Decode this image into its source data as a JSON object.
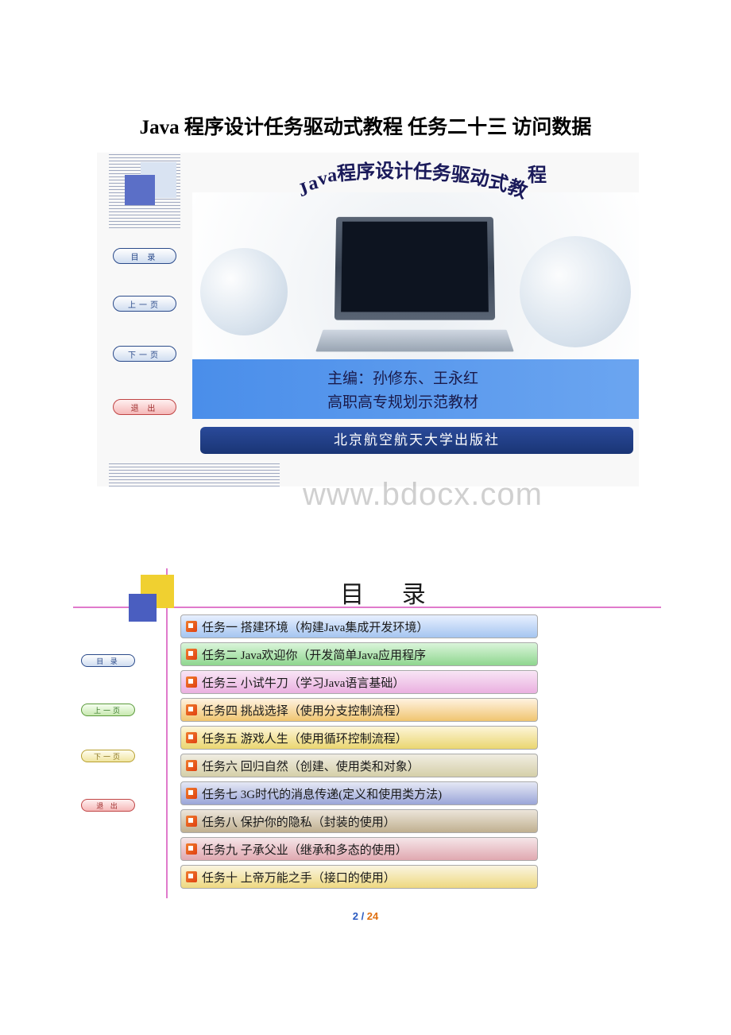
{
  "page_title": "Java 程序设计任务驱动式教程 任务二十三 访问数据",
  "slide1": {
    "curved_title_chars": [
      "J",
      "a",
      "v",
      "a",
      "程",
      "序",
      "设",
      "计",
      "任",
      "务",
      "驱",
      "动",
      "式",
      "教",
      "程"
    ],
    "nav": {
      "toc": "目 录",
      "prev": "上一页",
      "next": "下一页",
      "exit": "退 出"
    },
    "editors_line": "主编：孙修东、王永红",
    "subtitle_line": "高职高专规划示范教材",
    "publisher": "北京航空航天大学出版社",
    "watermark": "www.bdocx.com"
  },
  "slide2": {
    "title": "目 录",
    "nav": {
      "toc": "目 录",
      "prev": "上一页",
      "next": "下一页",
      "exit": "退 出"
    },
    "items": [
      {
        "label": "任务一  搭建环境（构建Java集成开发环境）",
        "grad": [
          "#e8f0ff",
          "#a5c5f0"
        ]
      },
      {
        "label": "任务二  Java欢迎你（开发简单Java应用程序",
        "grad": [
          "#daf5da",
          "#8fd68f"
        ]
      },
      {
        "label": "任务三  小试牛刀（学习Java语言基础）",
        "grad": [
          "#f8e5f5",
          "#eab0e0"
        ]
      },
      {
        "label": "任务四  挑战选择（使用分支控制流程）",
        "grad": [
          "#fff2e0",
          "#f0c570"
        ]
      },
      {
        "label": "任务五  游戏人生（使用循环控制流程）",
        "grad": [
          "#fdf5d8",
          "#ead670"
        ]
      },
      {
        "label": "任务六  回归自然（创建、使用类和对象）",
        "grad": [
          "#f0ede2",
          "#d5cfa8"
        ]
      },
      {
        "label": "任务七  3G时代的消息传递(定义和使用类方法)",
        "grad": [
          "#e5e8f5",
          "#9aa5d8"
        ]
      },
      {
        "label": "任务八  保护你的隐私（封装的使用）",
        "grad": [
          "#ece5da",
          "#c0b090"
        ]
      },
      {
        "label": "任务九  子承父业（继承和多态的使用）",
        "grad": [
          "#f5e5e8",
          "#e0a8b0"
        ]
      },
      {
        "label": "任务十  上帝万能之手（接口的使用）",
        "grad": [
          "#faf5e0",
          "#eed880"
        ]
      }
    ]
  },
  "page_number": {
    "current": "2",
    "total": "24"
  }
}
